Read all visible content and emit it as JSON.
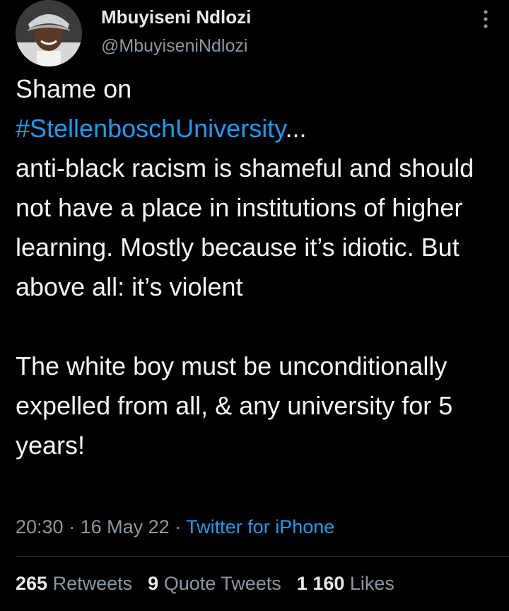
{
  "author": {
    "display_name": "Mbuyiseni Ndlozi",
    "handle": "@MbuyiseniNdlozi",
    "avatar_icon": "profile-photo"
  },
  "tweet": {
    "line1": "Shame on",
    "hashtag": "#StellenboschUniversity",
    "ellipsis": "...",
    "body": "anti-black racism is shameful and should not have a place in institutions of higher learning. Mostly because it’s idiotic. But above all: it’s violent\n\nThe white boy must be unconditionally expelled from all, & any university for 5 years!"
  },
  "meta": {
    "time": "20:30",
    "separator": " · ",
    "date": "16 May 22",
    "source": "Twitter for iPhone"
  },
  "stats": {
    "retweets_count": "265",
    "retweets_label": "Retweets",
    "quotes_count": "9",
    "quotes_label": "Quote Tweets",
    "likes_count": "1 160",
    "likes_label": "Likes"
  },
  "colors": {
    "background": "#000000",
    "link": "#1d9bf0",
    "secondary_text": "#8b98a5",
    "primary_text": "#e7e9ea"
  },
  "icons": {
    "more": "more-vertical-icon"
  }
}
